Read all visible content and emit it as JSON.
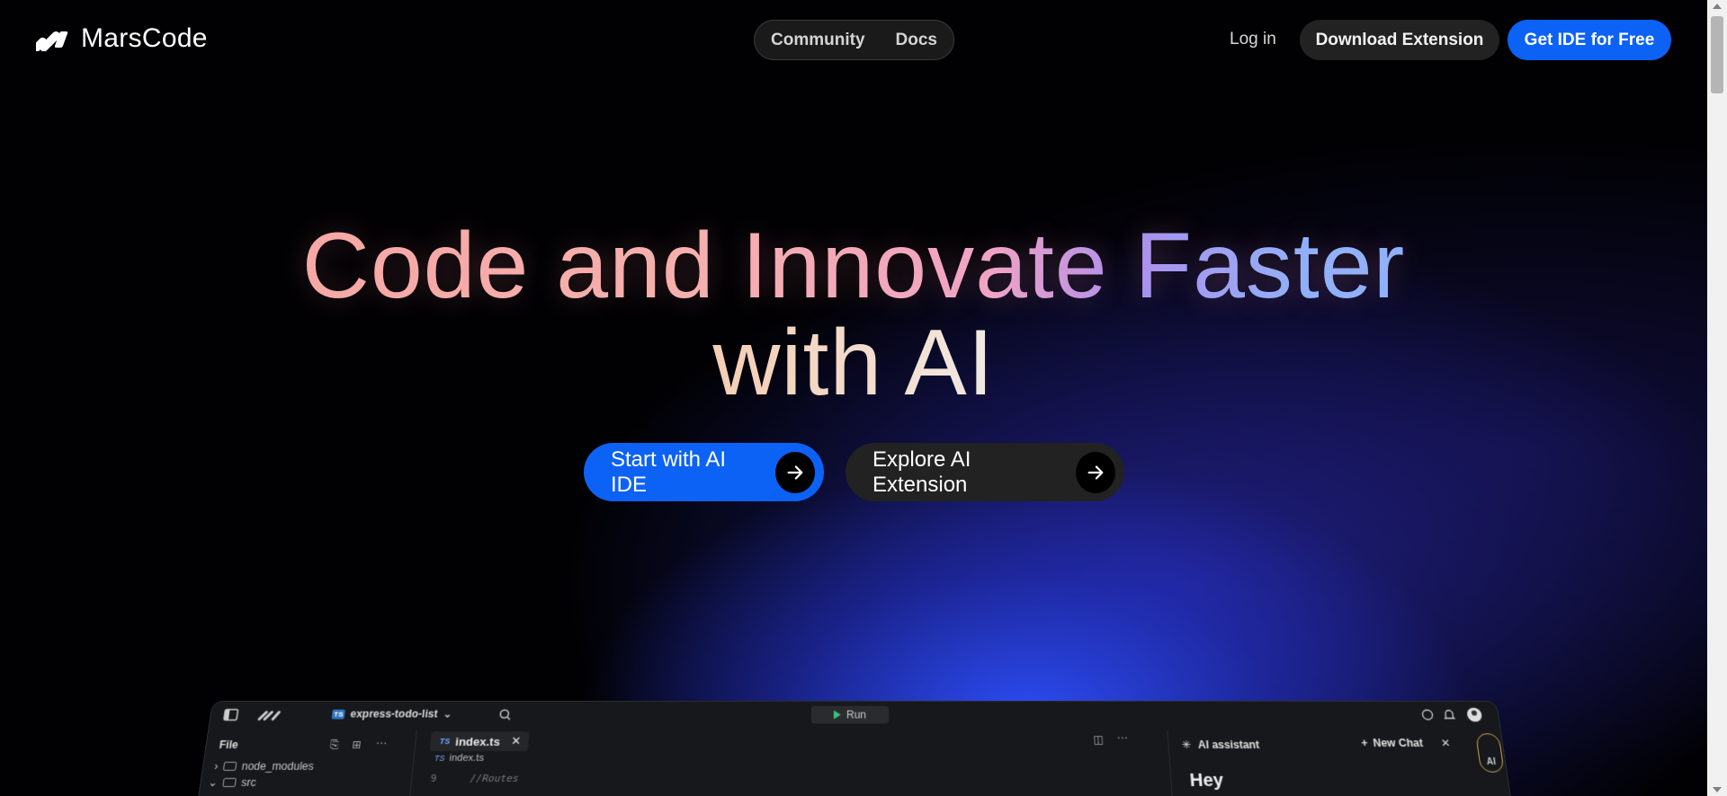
{
  "brand": {
    "name": "MarsCode",
    "logo_icon": "marscode-logo-icon"
  },
  "nav": {
    "community": "Community",
    "docs": "Docs"
  },
  "header_actions": {
    "login": "Log in",
    "download_extension": "Download Extension",
    "get_ide": "Get IDE for Free"
  },
  "hero": {
    "title_line1": "Code and Innovate Faster",
    "title_line2": "with AI",
    "cta_primary": "Start with AI IDE",
    "cta_secondary": "Explore AI Extension"
  },
  "ide_preview": {
    "project_name": "express-todo-list",
    "project_badge": "TS",
    "run_label": "Run",
    "file_label": "File",
    "tree": [
      "node_modules",
      "src"
    ],
    "tab_label": "index.ts",
    "tab_badge": "TS",
    "breadcrumb": "index.ts",
    "code_line_number": "9",
    "code_line": "//Routes",
    "ai_assistant_label": "AI assistant",
    "new_chat_label": "New Chat",
    "ai_pill_label": "AI",
    "ai_message_partial": "Hey"
  },
  "colors": {
    "accent_blue": "#0c62f5",
    "button_dark": "#222222",
    "background": "#010103"
  }
}
